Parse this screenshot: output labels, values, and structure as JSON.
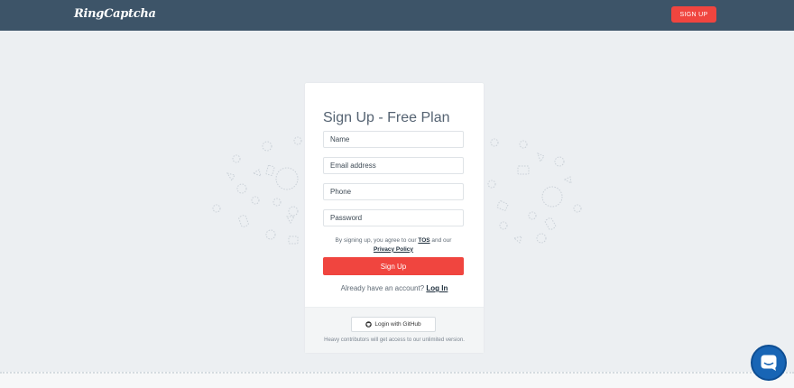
{
  "header": {
    "logo_text": "RingCaptcha",
    "signup_label": "SIGN UP"
  },
  "form": {
    "title": "Sign Up - Free Plan",
    "name_placeholder": "Name",
    "email_placeholder": "Email address",
    "phone_placeholder": "Phone",
    "password_placeholder": "Password",
    "terms_prefix": "By signing up, you agree to our",
    "terms_tos_link": "TOS",
    "terms_middle": "and our",
    "terms_privacy_link": "Privacy Policy",
    "submit_label": "Sign Up",
    "login_prompt": "Already have an account?",
    "login_link": "Log In"
  },
  "footer": {
    "github_label": "Login with GitHub",
    "note": "Heavy contributors will get access to our unlimited version."
  },
  "colors": {
    "header_bg": "#3d5468",
    "accent": "#f0453f",
    "page_bg": "#eceff2",
    "chat_bg": "#1865b5"
  },
  "icons": {
    "github": "github-icon",
    "chat": "chat-icon"
  }
}
